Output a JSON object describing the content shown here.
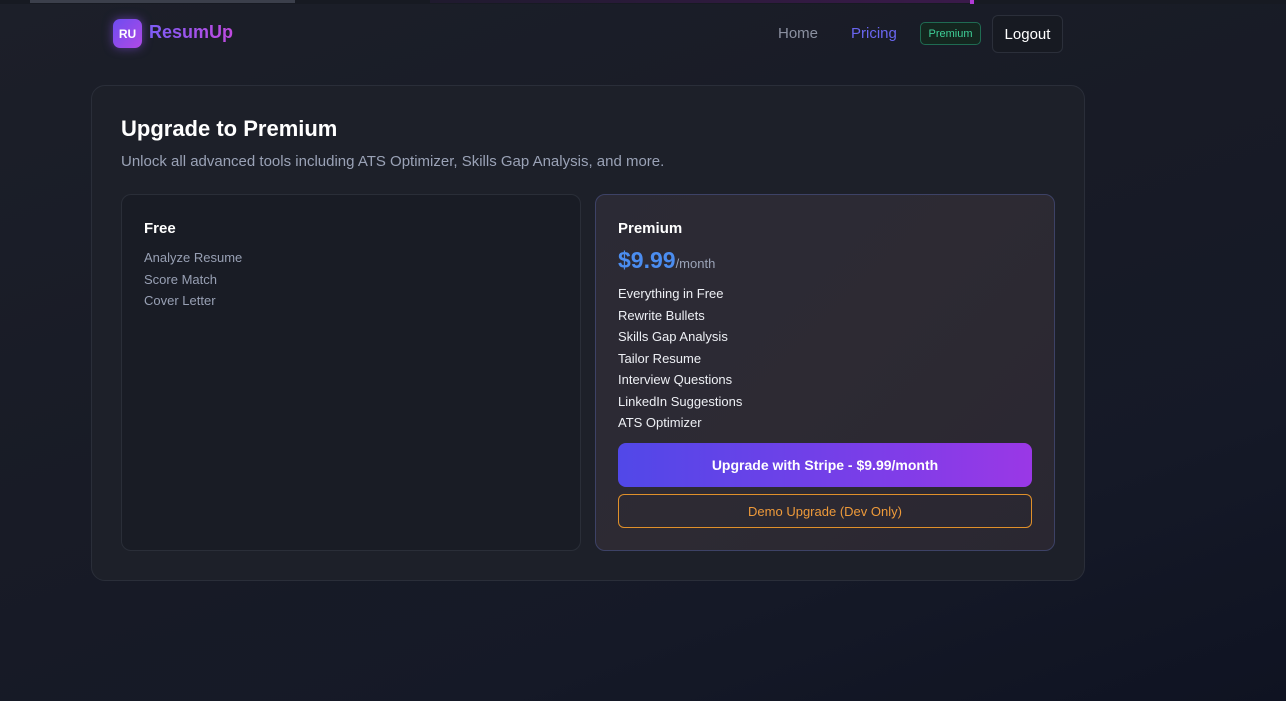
{
  "brand": {
    "logo_initials": "RU",
    "name": "ResumUp"
  },
  "nav": {
    "home_label": "Home",
    "pricing_label": "Pricing",
    "premium_badge": "Premium",
    "logout_label": "Logout"
  },
  "page": {
    "title": "Upgrade to Premium",
    "subtitle": "Unlock all advanced tools including ATS Optimizer, Skills Gap Analysis, and more."
  },
  "plans": {
    "free": {
      "name": "Free",
      "features": [
        "Analyze Resume",
        "Score Match",
        "Cover Letter"
      ]
    },
    "premium": {
      "name": "Premium",
      "price": "$9.99",
      "period": "/month",
      "features": [
        "Everything in Free",
        "Rewrite Bullets",
        "Skills Gap Analysis",
        "Tailor Resume",
        "Interview Questions",
        "LinkedIn Suggestions",
        "ATS Optimizer"
      ],
      "stripe_button_label": "Upgrade with Stripe - $9.99/month",
      "demo_button_label": "Demo Upgrade (Dev Only)"
    }
  },
  "colors": {
    "accent": "#6a66f0",
    "brand_gradient_start": "#7c5cf5",
    "brand_gradient_end": "#c04ae0",
    "price": "#4b8df0",
    "badge_green": "#3ecf98",
    "demo_orange": "#ee9a3a"
  }
}
